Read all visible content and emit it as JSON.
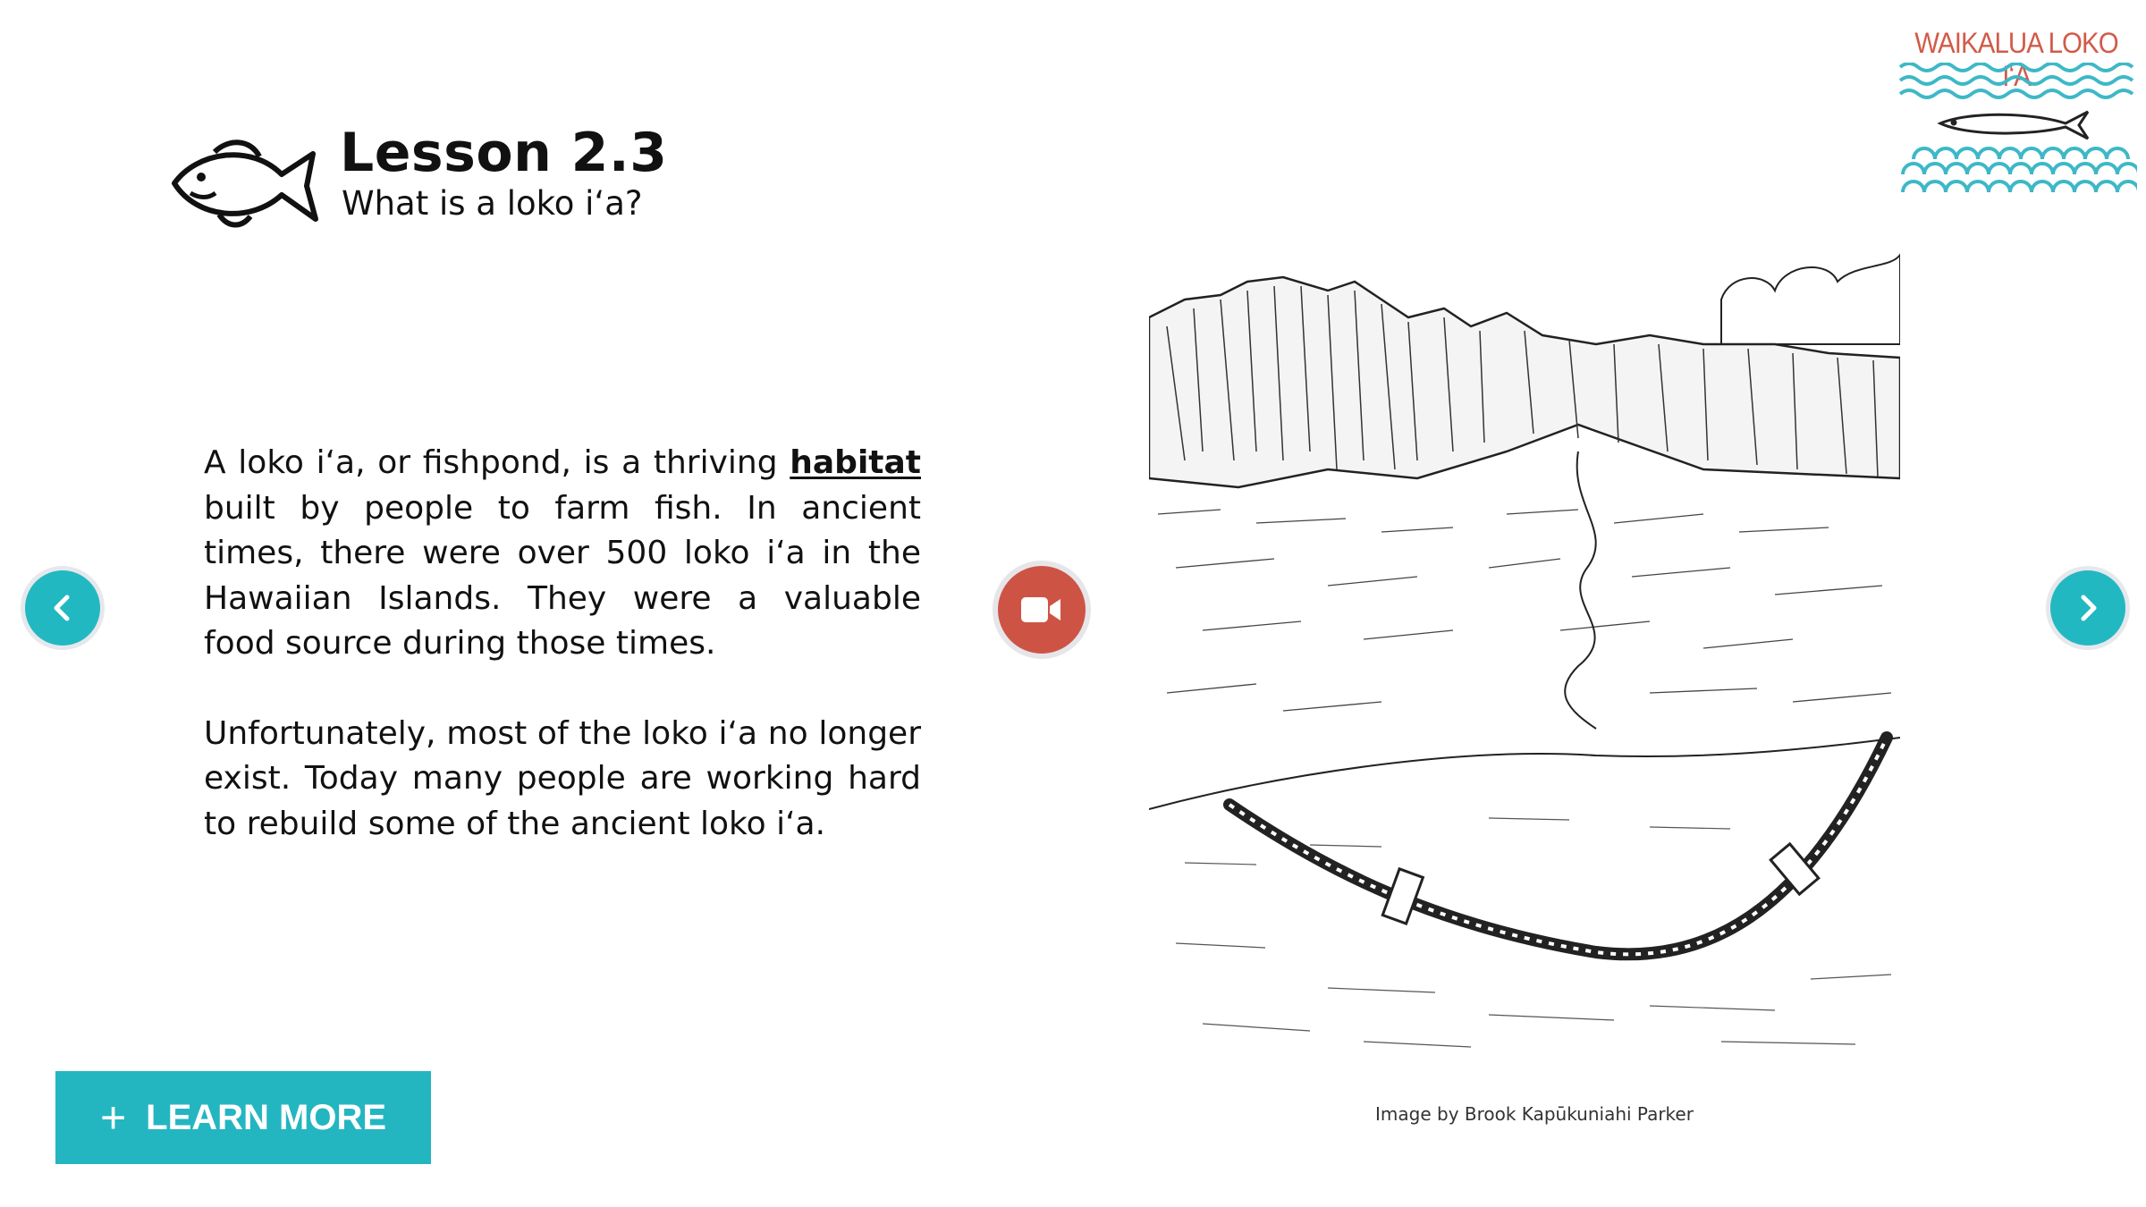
{
  "header": {
    "title": "Lesson 2.3",
    "subtitle": "What is a loko iʻa?"
  },
  "logo": {
    "text": "WAIKALUA LOKO IʻA"
  },
  "content": {
    "p1_before": "A loko iʻa, or fishpond, is a thriving ",
    "p1_term": "habitat",
    "p1_after": " built by people to farm fish. In ancient times, there were over 500 loko iʻa in the Hawaiian Islands. They were a valuable food source during those times.",
    "p2": "Unfortunately, most of the loko iʻa no longer exist. Today many people are working hard to rebuild some of the ancient loko iʻa."
  },
  "image_credit": "Image by Brook Kapūkuniahi Parker",
  "learn_more": {
    "icon": "+",
    "label": "LEARN MORE"
  },
  "icons": {
    "prev": "chevron-left-icon",
    "next": "chevron-right-icon",
    "video": "video-camera-icon",
    "header": "fish-icon"
  },
  "colors": {
    "accent": "#22b8c2",
    "video_button": "#cd5445",
    "logo_text": "#d15b48",
    "logo_waves": "#3db8c7"
  }
}
